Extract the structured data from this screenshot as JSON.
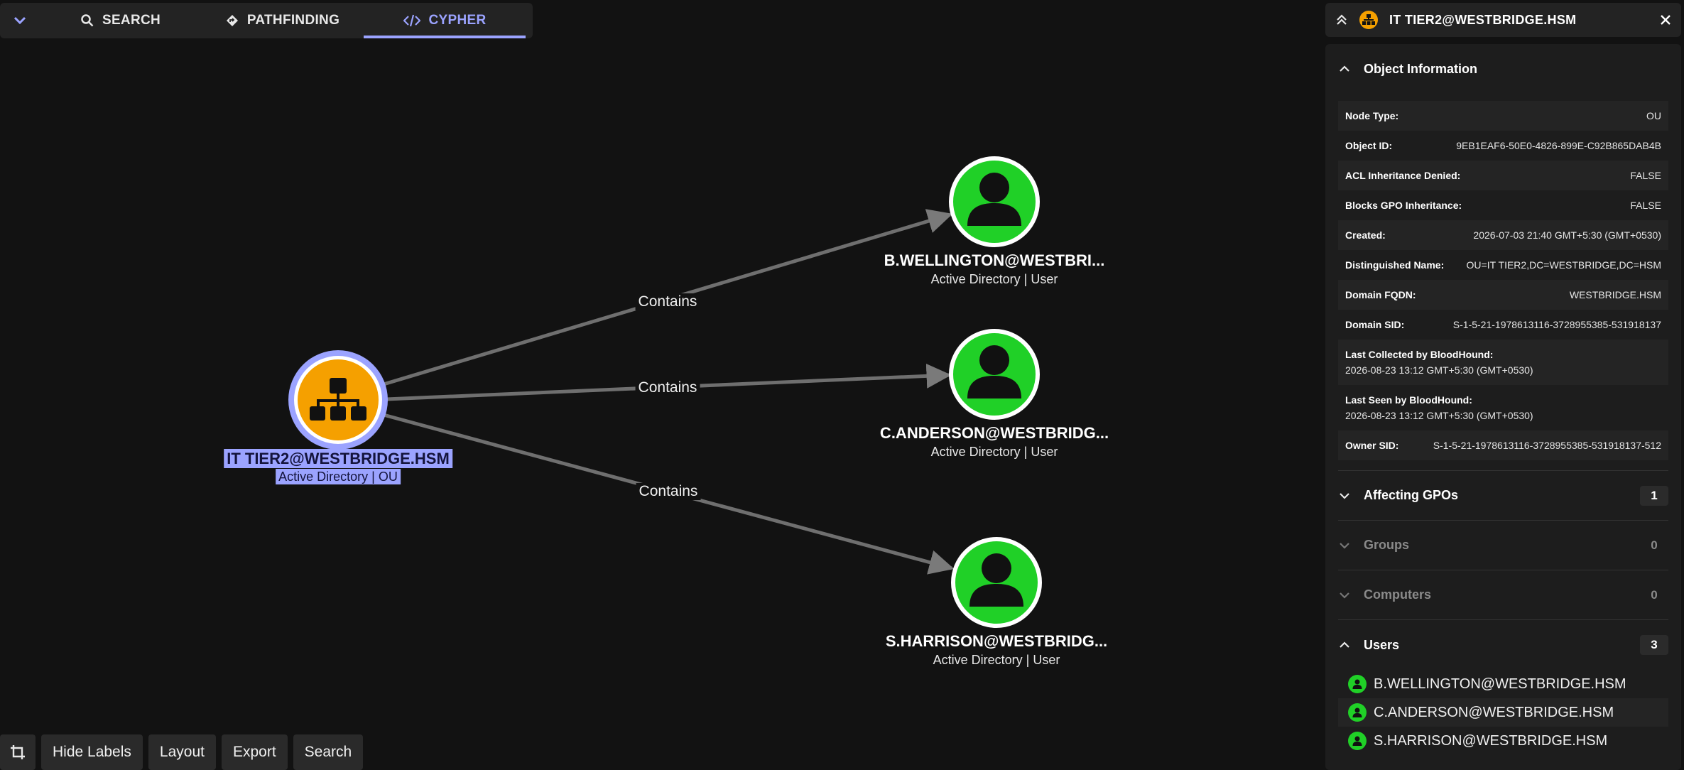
{
  "tabs": [
    {
      "label": "SEARCH",
      "icon": "search-icon"
    },
    {
      "label": "PATHFINDING",
      "icon": "pathfinding-icon"
    },
    {
      "label": "CYPHER",
      "icon": "code-icon",
      "active": true
    }
  ],
  "graph": {
    "ou_node": {
      "name": "IT TIER2@WESTBRIDGE.HSM",
      "subtitle": "Active Directory | OU",
      "color": "#f5a000"
    },
    "users": [
      {
        "name": "B.WELLINGTON@WESTBRI...",
        "subtitle": "Active Directory | User",
        "edge_label": "Contains"
      },
      {
        "name": "C.ANDERSON@WESTBRIDG...",
        "subtitle": "Active Directory | User",
        "edge_label": "Contains"
      },
      {
        "name": "S.HARRISON@WESTBRIDG...",
        "subtitle": "Active Directory | User",
        "edge_label": "Contains"
      }
    ],
    "user_color": "#20d027",
    "selection_color": "#9ba3ff"
  },
  "toolbar": {
    "hide_labels": "Hide Labels",
    "layout": "Layout",
    "export": "Export",
    "search": "Search"
  },
  "panel": {
    "title": "IT TIER2@WESTBRIDGE.HSM",
    "object_info_title": "Object Information",
    "info": [
      {
        "key": "Node Type:",
        "value": "OU"
      },
      {
        "key": "Object ID:",
        "value": "9EB1EAF6-50E0-4826-899E-C92B865DAB4B"
      },
      {
        "key": "ACL Inheritance Denied:",
        "value": "FALSE"
      },
      {
        "key": "Blocks GPO Inheritance:",
        "value": "FALSE"
      },
      {
        "key": "Created:",
        "value": "2026-07-03 21:40 GMT+5:30 (GMT+0530)"
      },
      {
        "key": "Distinguished Name:",
        "value": "OU=IT TIER2,DC=WESTBRIDGE,DC=HSM"
      },
      {
        "key": "Domain FQDN:",
        "value": "WESTBRIDGE.HSM"
      },
      {
        "key": "Domain SID:",
        "value": "S-1-5-21-1978613116-3728955385-531918137"
      },
      {
        "key": "Last Collected by BloodHound:",
        "value": "2026-08-23 13:12 GMT+5:30 (GMT+0530)"
      },
      {
        "key": "Last Seen by BloodHound:",
        "value": "2026-08-23 13:12 GMT+5:30 (GMT+0530)"
      },
      {
        "key": "Owner SID:",
        "value": "S-1-5-21-1978613116-3728955385-531918137-512"
      }
    ],
    "sections": [
      {
        "title": "Affecting GPOs",
        "count": "1"
      },
      {
        "title": "Groups",
        "count": "0"
      },
      {
        "title": "Computers",
        "count": "0"
      },
      {
        "title": "Users",
        "count": "3"
      }
    ],
    "users_list": [
      "B.WELLINGTON@WESTBRIDGE.HSM",
      "C.ANDERSON@WESTBRIDGE.HSM",
      "S.HARRISON@WESTBRIDGE.HSM"
    ]
  }
}
